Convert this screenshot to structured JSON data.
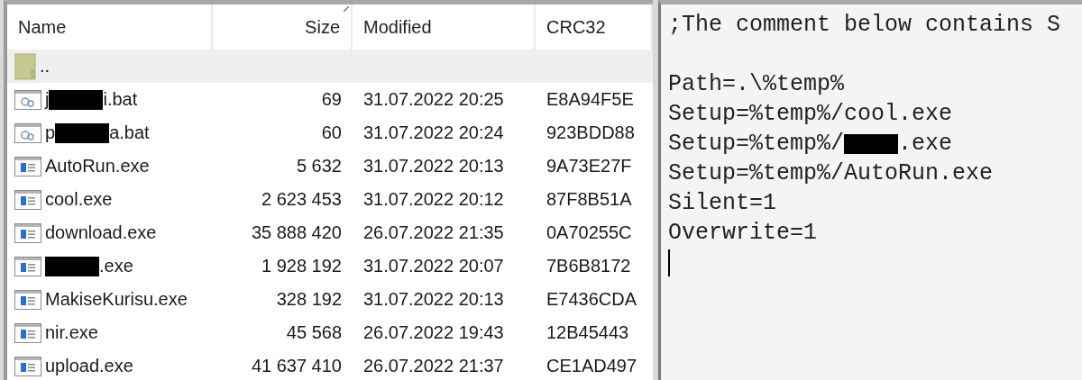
{
  "file_list": {
    "columns": [
      {
        "label": "Name",
        "sorted": false
      },
      {
        "label": "Size",
        "sorted": true
      },
      {
        "label": "Modified",
        "sorted": false
      },
      {
        "label": "CRC32",
        "sorted": false
      }
    ],
    "rows": [
      {
        "kind": "parent",
        "selected": true,
        "name": [
          {
            "kind": "text",
            "text": ".."
          }
        ]
      },
      {
        "kind": "batch",
        "selected": false,
        "name": [
          {
            "kind": "text",
            "text": "j"
          },
          {
            "kind": "redaction"
          },
          {
            "kind": "text",
            "text": "i.bat"
          }
        ],
        "size": "69",
        "modified": "31.07.2022 20:25",
        "crc": "E8A94F5E"
      },
      {
        "kind": "batch",
        "selected": false,
        "name": [
          {
            "kind": "text",
            "text": "p"
          },
          {
            "kind": "redaction"
          },
          {
            "kind": "text",
            "text": "a.bat"
          }
        ],
        "size": "60",
        "modified": "31.07.2022 20:24",
        "crc": "923BDD88"
      },
      {
        "kind": "exe",
        "selected": false,
        "name": [
          {
            "kind": "text",
            "text": "AutoRun.exe"
          }
        ],
        "size": "5 632",
        "modified": "31.07.2022 20:13",
        "crc": "9A73E27F"
      },
      {
        "kind": "exe",
        "selected": false,
        "name": [
          {
            "kind": "text",
            "text": "cool.exe"
          }
        ],
        "size": "2 623 453",
        "modified": "31.07.2022 20:12",
        "crc": "87F8B51A"
      },
      {
        "kind": "exe",
        "selected": false,
        "name": [
          {
            "kind": "text",
            "text": "download.exe"
          }
        ],
        "size": "35 888 420",
        "modified": "26.07.2022 21:35",
        "crc": "0A70255C"
      },
      {
        "kind": "exe",
        "selected": false,
        "name": [
          {
            "kind": "redaction"
          },
          {
            "kind": "text",
            "text": ".exe"
          }
        ],
        "size": "1 928 192",
        "modified": "31.07.2022 20:07",
        "crc": "7B6B8172"
      },
      {
        "kind": "exe",
        "selected": false,
        "name": [
          {
            "kind": "text",
            "text": "MakiseKurisu.exe"
          }
        ],
        "size": "328 192",
        "modified": "31.07.2022 20:13",
        "crc": "E7436CDA"
      },
      {
        "kind": "exe",
        "selected": false,
        "name": [
          {
            "kind": "text",
            "text": "nir.exe"
          }
        ],
        "size": "45 568",
        "modified": "26.07.2022 19:43",
        "crc": "12B45443"
      },
      {
        "kind": "exe",
        "selected": false,
        "name": [
          {
            "kind": "text",
            "text": "upload.exe"
          }
        ],
        "size": "41 637 410",
        "modified": "26.07.2022 21:37",
        "crc": "CE1AD497"
      }
    ]
  },
  "comment": {
    "cursor": true,
    "lines": [
      {
        "kind": "text",
        "parts": [
          {
            "kind": "text",
            "text": ";The comment below contains S"
          }
        ]
      },
      {
        "kind": "blank"
      },
      {
        "kind": "text",
        "parts": [
          {
            "kind": "text",
            "text": "Path=.\\%temp%"
          }
        ]
      },
      {
        "kind": "text",
        "parts": [
          {
            "kind": "text",
            "text": "Setup=%temp%/cool.exe"
          }
        ]
      },
      {
        "kind": "text",
        "parts": [
          {
            "kind": "text",
            "text": "Setup=%temp%/"
          },
          {
            "kind": "redaction"
          },
          {
            "kind": "text",
            "text": ".exe"
          }
        ]
      },
      {
        "kind": "text",
        "parts": [
          {
            "kind": "text",
            "text": "Setup=%temp%/AutoRun.exe"
          }
        ]
      },
      {
        "kind": "text",
        "parts": [
          {
            "kind": "text",
            "text": "Silent=1"
          }
        ]
      },
      {
        "kind": "text",
        "parts": [
          {
            "kind": "text",
            "text": "Overwrite=1"
          }
        ]
      }
    ]
  }
}
